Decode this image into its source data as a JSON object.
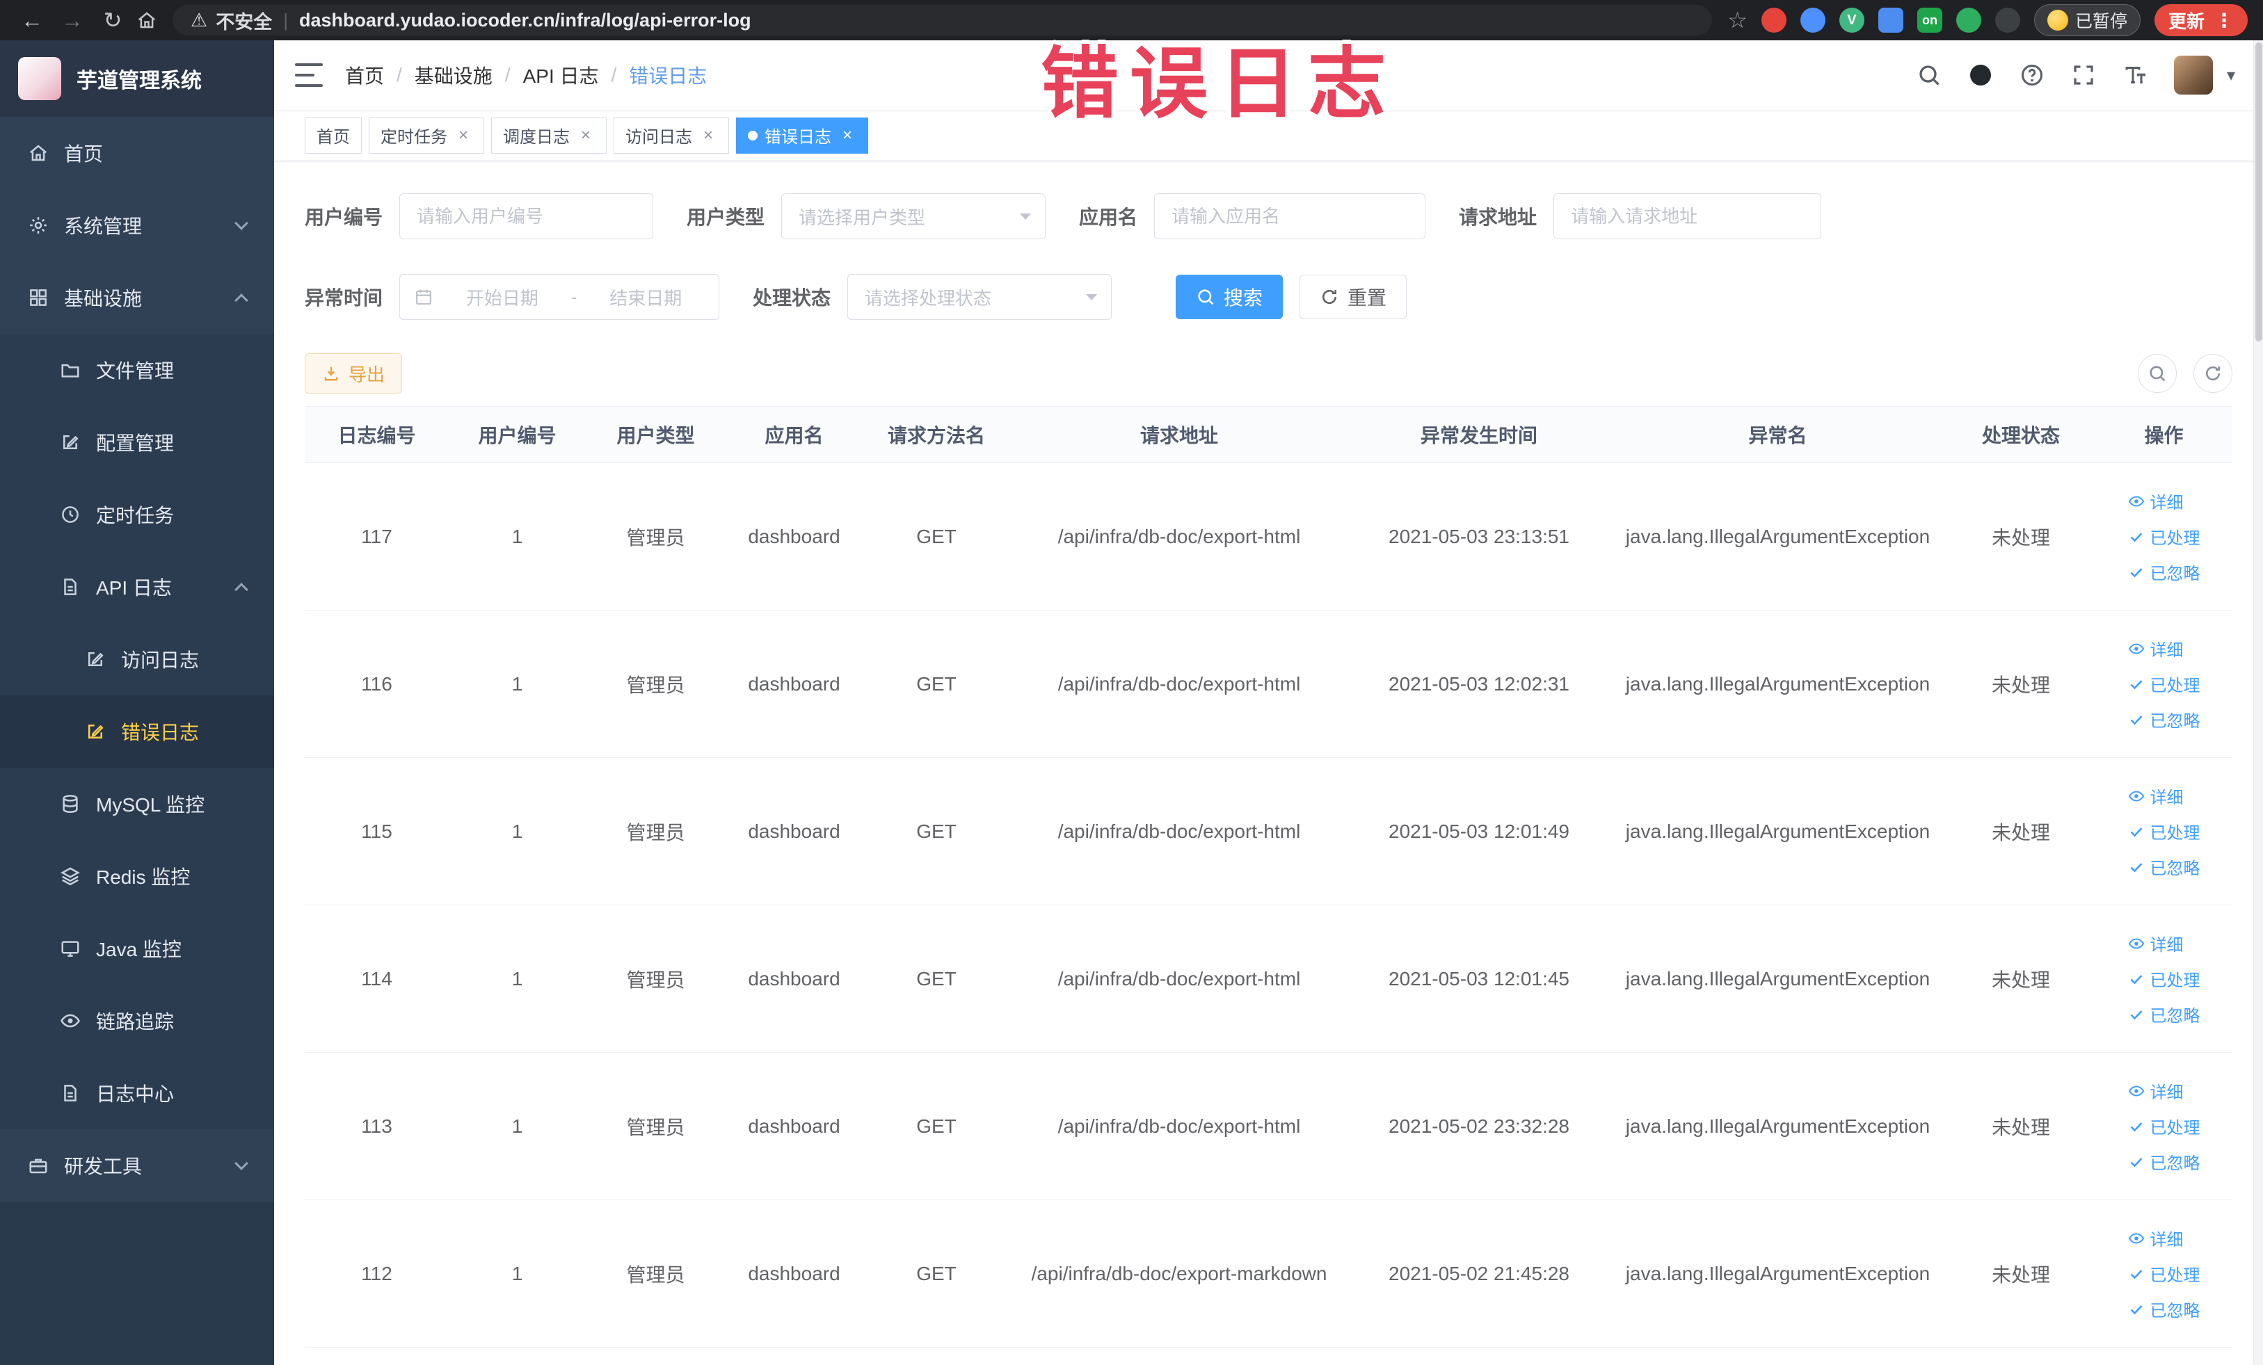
{
  "browser": {
    "security_label": "不安全",
    "url": "dashboard.yudao.iocoder.cn/infra/log/api-error-log",
    "paused_label": "已暂停",
    "update_label": "更新",
    "ext_vue_badge": "V",
    "ext_on_badge": "on"
  },
  "icons": {
    "back": "←",
    "forward": "→",
    "reload": "↻",
    "warning": "⚠",
    "star": "☆",
    "kebab": "⋮",
    "close": "×",
    "caret": "▾",
    "divider": "|",
    "range_separator": "-"
  },
  "sidebar": {
    "logo_title": "芋道管理系统",
    "items": [
      {
        "label": "首页"
      },
      {
        "label": "系统管理"
      },
      {
        "label": "基础设施"
      },
      {
        "label": "文件管理"
      },
      {
        "label": "配置管理"
      },
      {
        "label": "定时任务"
      },
      {
        "label": "API 日志"
      },
      {
        "label": "访问日志"
      },
      {
        "label": "错误日志"
      },
      {
        "label": "MySQL 监控"
      },
      {
        "label": "Redis 监控"
      },
      {
        "label": "Java 监控"
      },
      {
        "label": "链路追踪"
      },
      {
        "label": "日志中心"
      },
      {
        "label": "研发工具"
      }
    ]
  },
  "breadcrumb": {
    "items": [
      "首页",
      "基础设施",
      "API 日志",
      "错误日志"
    ],
    "separator": "/"
  },
  "tabs": [
    {
      "label": "首页"
    },
    {
      "label": "定时任务"
    },
    {
      "label": "调度日志"
    },
    {
      "label": "访问日志"
    },
    {
      "label": "错误日志"
    }
  ],
  "watermark": {
    "text": "错误日志",
    "color": "#E8415A"
  },
  "filters": {
    "user_id_label": "用户编号",
    "user_id_placeholder": "请输入用户编号",
    "user_type_label": "用户类型",
    "user_type_placeholder": "请选择用户类型",
    "app_name_label": "应用名",
    "app_name_placeholder": "请输入应用名",
    "request_url_label": "请求地址",
    "request_url_placeholder": "请输入请求地址",
    "time_label": "异常时间",
    "time_start_placeholder": "开始日期",
    "time_end_placeholder": "结束日期",
    "status_label": "处理状态",
    "status_placeholder": "请选择处理状态",
    "search_label": "搜索",
    "reset_label": "重置"
  },
  "toolbar": {
    "export_label": "导出"
  },
  "table": {
    "columns": [
      "日志编号",
      "用户编号",
      "用户类型",
      "应用名",
      "请求方法名",
      "请求地址",
      "异常发生时间",
      "异常名",
      "处理状态",
      "操作"
    ],
    "actions": {
      "detail": "详细",
      "processed": "已处理",
      "ignored": "已忽略"
    },
    "rows": [
      {
        "id": "117",
        "user_id": "1",
        "user_type": "管理员",
        "app": "dashboard",
        "method": "GET",
        "url": "/api/infra/db-doc/export-html",
        "time": "2021-05-03 23:13:51",
        "exception": "java.lang.IllegalArgumentException",
        "status": "未处理"
      },
      {
        "id": "116",
        "user_id": "1",
        "user_type": "管理员",
        "app": "dashboard",
        "method": "GET",
        "url": "/api/infra/db-doc/export-html",
        "time": "2021-05-03 12:02:31",
        "exception": "java.lang.IllegalArgumentException",
        "status": "未处理"
      },
      {
        "id": "115",
        "user_id": "1",
        "user_type": "管理员",
        "app": "dashboard",
        "method": "GET",
        "url": "/api/infra/db-doc/export-html",
        "time": "2021-05-03 12:01:49",
        "exception": "java.lang.IllegalArgumentException",
        "status": "未处理"
      },
      {
        "id": "114",
        "user_id": "1",
        "user_type": "管理员",
        "app": "dashboard",
        "method": "GET",
        "url": "/api/infra/db-doc/export-html",
        "time": "2021-05-03 12:01:45",
        "exception": "java.lang.IllegalArgumentException",
        "status": "未处理"
      },
      {
        "id": "113",
        "user_id": "1",
        "user_type": "管理员",
        "app": "dashboard",
        "method": "GET",
        "url": "/api/infra/db-doc/export-html",
        "time": "2021-05-02 23:32:28",
        "exception": "java.lang.IllegalArgumentException",
        "status": "未处理"
      },
      {
        "id": "112",
        "user_id": "1",
        "user_type": "管理员",
        "app": "dashboard",
        "method": "GET",
        "url": "/api/infra/db-doc/export-markdown",
        "time": "2021-05-02 21:45:28",
        "exception": "java.lang.IllegalArgumentException",
        "status": "未处理"
      }
    ]
  },
  "colors": {
    "primary": "#409EFF",
    "warning": "#E6A23C",
    "sidebar_bg": "#304156",
    "menu_active": "#FFD04B"
  }
}
